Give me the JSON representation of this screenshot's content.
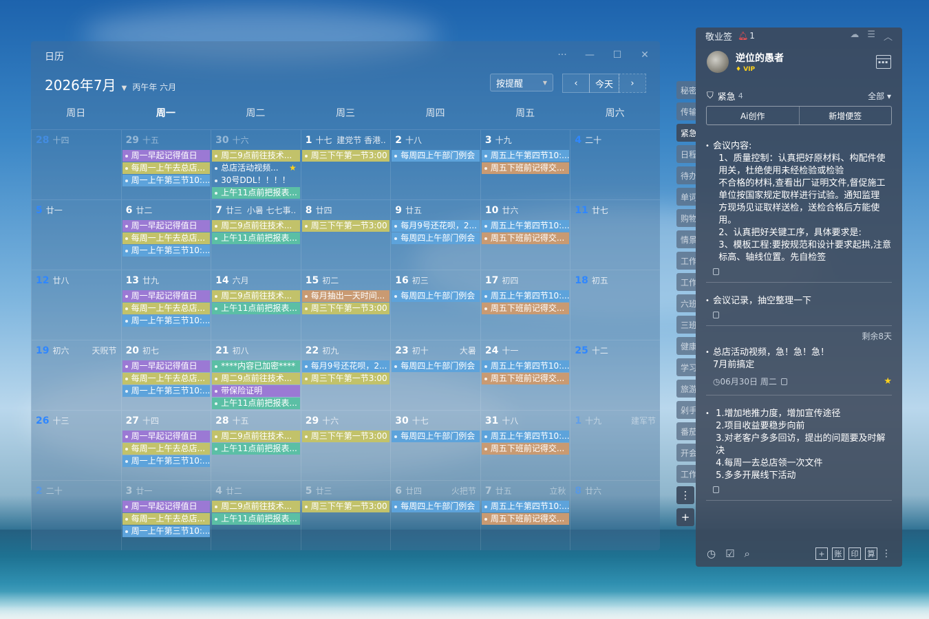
{
  "calendar": {
    "title": "日历",
    "month": "2026年7月",
    "lunar": "丙午年 六月",
    "remind_select": "按提醒",
    "today_label": "今天",
    "weekdays": [
      "周日",
      "周一",
      "周二",
      "周三",
      "周四",
      "周五",
      "周六"
    ],
    "active_weekday": 1,
    "weeks": [
      [
        {
          "num": "28",
          "lunar": "十四",
          "dim": true,
          "wknd": true,
          "events": []
        },
        {
          "num": "29",
          "lunar": "十五",
          "dim": true,
          "events": [
            {
              "t": "周一早起记得值日",
              "c": "purple"
            },
            {
              "t": "每周一上午去总店...",
              "c": "olive"
            },
            {
              "t": "周一上午第三节10:...",
              "c": "blue"
            }
          ]
        },
        {
          "num": "30",
          "lunar": "十六",
          "dim": true,
          "events": [
            {
              "t": "周二9点前往技术...",
              "c": "olive"
            },
            {
              "t": "总店活动视频...",
              "c": "plain",
              "star": true
            },
            {
              "t": "30号DDL！！！！",
              "c": "plain"
            },
            {
              "t": "上午11点前把报表...",
              "c": "teal"
            }
          ]
        },
        {
          "num": "1",
          "lunar": "十七",
          "fest": "建党节 香港...",
          "events": [
            {
              "t": "周三下午第一节3:00",
              "c": "olive"
            }
          ]
        },
        {
          "num": "2",
          "lunar": "十八",
          "events": [
            {
              "t": "每周四上午部门例会",
              "c": "blue"
            }
          ]
        },
        {
          "num": "3",
          "lunar": "十九",
          "events": [
            {
              "t": "周五上午第四节10:...",
              "c": "blue"
            },
            {
              "t": "周五下班前记得交...",
              "c": "orange"
            }
          ]
        },
        {
          "num": "4",
          "lunar": "二十",
          "wknd": true,
          "events": []
        }
      ],
      [
        {
          "num": "5",
          "lunar": "廿一",
          "wknd": true,
          "events": []
        },
        {
          "num": "6",
          "lunar": "廿二",
          "events": [
            {
              "t": "周一早起记得值日",
              "c": "purple"
            },
            {
              "t": "每周一上午去总店...",
              "c": "olive"
            },
            {
              "t": "周一上午第三节10:...",
              "c": "blue"
            }
          ]
        },
        {
          "num": "7",
          "lunar": "廿三",
          "fest": "小暑 七七事...",
          "events": [
            {
              "t": "周二9点前往技术...",
              "c": "olive"
            },
            {
              "t": "上午11点前把报表...",
              "c": "teal"
            }
          ]
        },
        {
          "num": "8",
          "lunar": "廿四",
          "events": [
            {
              "t": "周三下午第一节3:00",
              "c": "olive"
            }
          ]
        },
        {
          "num": "9",
          "lunar": "廿五",
          "events": [
            {
              "t": "每月9号还花呗，2...",
              "c": "blue"
            },
            {
              "t": "每周四上午部门例会",
              "c": "blue"
            }
          ]
        },
        {
          "num": "10",
          "lunar": "廿六",
          "events": [
            {
              "t": "周五上午第四节10:...",
              "c": "blue"
            },
            {
              "t": "周五下班前记得交...",
              "c": "orange"
            }
          ]
        },
        {
          "num": "11",
          "lunar": "廿七",
          "wknd": true,
          "events": []
        }
      ],
      [
        {
          "num": "12",
          "lunar": "廿八",
          "wknd": true,
          "events": []
        },
        {
          "num": "13",
          "lunar": "廿九",
          "events": [
            {
              "t": "周一早起记得值日",
              "c": "purple"
            },
            {
              "t": "每周一上午去总店...",
              "c": "olive"
            },
            {
              "t": "周一上午第三节10:...",
              "c": "blue"
            }
          ]
        },
        {
          "num": "14",
          "lunar": "六月",
          "events": [
            {
              "t": "周二9点前往技术...",
              "c": "olive"
            },
            {
              "t": "上午11点前把报表...",
              "c": "teal"
            }
          ]
        },
        {
          "num": "15",
          "lunar": "初二",
          "events": [
            {
              "t": "每月抽出一天时间...",
              "c": "orange"
            },
            {
              "t": "周三下午第一节3:00",
              "c": "olive"
            }
          ]
        },
        {
          "num": "16",
          "lunar": "初三",
          "events": [
            {
              "t": "每周四上午部门例会",
              "c": "blue"
            }
          ]
        },
        {
          "num": "17",
          "lunar": "初四",
          "events": [
            {
              "t": "周五上午第四节10:...",
              "c": "blue"
            },
            {
              "t": "周五下班前记得交...",
              "c": "orange"
            }
          ]
        },
        {
          "num": "18",
          "lunar": "初五",
          "wknd": true,
          "events": []
        }
      ],
      [
        {
          "num": "19",
          "lunar": "初六",
          "fest": "天贶节",
          "wknd": true,
          "events": []
        },
        {
          "num": "20",
          "lunar": "初七",
          "events": [
            {
              "t": "周一早起记得值日",
              "c": "purple"
            },
            {
              "t": "每周一上午去总店...",
              "c": "olive"
            },
            {
              "t": "周一上午第三节10:...",
              "c": "blue"
            }
          ]
        },
        {
          "num": "21",
          "lunar": "初八",
          "events": [
            {
              "t": "****内容已加密****",
              "c": "teal"
            },
            {
              "t": "周二9点前往技术...",
              "c": "olive"
            },
            {
              "t": "带保险证明",
              "c": "purple"
            },
            {
              "t": "上午11点前把报表...",
              "c": "teal"
            }
          ]
        },
        {
          "num": "22",
          "lunar": "初九",
          "events": [
            {
              "t": "每月9号还花呗，2...",
              "c": "blue"
            },
            {
              "t": "周三下午第一节3:00",
              "c": "olive"
            }
          ]
        },
        {
          "num": "23",
          "lunar": "初十",
          "fest": "大暑",
          "events": [
            {
              "t": "每周四上午部门例会",
              "c": "blue"
            }
          ]
        },
        {
          "num": "24",
          "lunar": "十一",
          "events": [
            {
              "t": "周五上午第四节10:...",
              "c": "blue"
            },
            {
              "t": "周五下班前记得交...",
              "c": "orange"
            }
          ]
        },
        {
          "num": "25",
          "lunar": "十二",
          "wknd": true,
          "events": []
        }
      ],
      [
        {
          "num": "26",
          "lunar": "十三",
          "wknd": true,
          "events": []
        },
        {
          "num": "27",
          "lunar": "十四",
          "events": [
            {
              "t": "周一早起记得值日",
              "c": "purple"
            },
            {
              "t": "每周一上午去总店...",
              "c": "olive"
            },
            {
              "t": "周一上午第三节10:...",
              "c": "blue"
            }
          ]
        },
        {
          "num": "28",
          "lunar": "十五",
          "events": [
            {
              "t": "周二9点前往技术...",
              "c": "olive"
            },
            {
              "t": "上午11点前把报表...",
              "c": "teal"
            }
          ]
        },
        {
          "num": "29",
          "lunar": "十六",
          "events": [
            {
              "t": "周三下午第一节3:00",
              "c": "olive"
            }
          ]
        },
        {
          "num": "30",
          "lunar": "十七",
          "events": [
            {
              "t": "每周四上午部门例会",
              "c": "blue"
            }
          ]
        },
        {
          "num": "31",
          "lunar": "十八",
          "events": [
            {
              "t": "周五上午第四节10:...",
              "c": "blue"
            },
            {
              "t": "周五下班前记得交...",
              "c": "orange"
            }
          ]
        },
        {
          "num": "1",
          "lunar": "十九",
          "fest": "建军节",
          "dim": true,
          "wknd": true,
          "events": []
        }
      ],
      [
        {
          "num": "2",
          "lunar": "二十",
          "dim": true,
          "wknd": true,
          "events": []
        },
        {
          "num": "3",
          "lunar": "廿一",
          "dim": true,
          "events": [
            {
              "t": "周一早起记得值日",
              "c": "purple"
            },
            {
              "t": "每周一上午去总店...",
              "c": "olive"
            },
            {
              "t": "周一上午第三节10:...",
              "c": "blue"
            }
          ]
        },
        {
          "num": "4",
          "lunar": "廿二",
          "dim": true,
          "events": [
            {
              "t": "周二9点前往技术...",
              "c": "olive"
            },
            {
              "t": "上午11点前把报表...",
              "c": "teal"
            }
          ]
        },
        {
          "num": "5",
          "lunar": "廿三",
          "dim": true,
          "events": [
            {
              "t": "周三下午第一节3:00",
              "c": "olive"
            }
          ]
        },
        {
          "num": "6",
          "lunar": "廿四",
          "fest": "火把节",
          "dim": true,
          "events": [
            {
              "t": "每周四上午部门例会",
              "c": "blue"
            }
          ]
        },
        {
          "num": "7",
          "lunar": "廿五",
          "fest": "立秋",
          "dim": true,
          "events": [
            {
              "t": "周五上午第四节10:...",
              "c": "blue"
            },
            {
              "t": "周五下班前记得交...",
              "c": "orange"
            }
          ]
        },
        {
          "num": "8",
          "lunar": "廿六",
          "dim": true,
          "wknd": true,
          "events": []
        }
      ]
    ]
  },
  "side_tabs": [
    "秘密",
    "传输",
    "紧急",
    "日程",
    "待办",
    "单词",
    "购物",
    "情景",
    "工作",
    "工作",
    "六班",
    "三班",
    "健康",
    "学习",
    "旅游",
    "剁手",
    "番茄",
    "开会",
    "工作"
  ],
  "side_tabs_active": 2,
  "side_more": "⋮",
  "side_add": "+",
  "note": {
    "app_title": "敬业签",
    "bell_count": "1",
    "username": "逆位的愚者",
    "vip_label": "VIP",
    "category": "紧急",
    "category_count": "4",
    "filter": "全部",
    "ai_button": "Ai创作",
    "new_button": "新增便签",
    "items": [
      {
        "text": "会议内容:\n  1、质量控制：认真把好原材料、构配件使\n  用关，杜绝使用未经检验或检验\n  不合格的材料,查看出厂证明文件,督促施工\n  单位按国家规定取样进行试验。通知监理\n  方现场见证取样送检，送检合格后方能使\n  用。\n  2、认真把好关键工序，具体要求是:\n  3、模板工程:要按规范和设计要求起拱,注意\n  标高、轴线位置。先自检签"
      },
      {
        "text": "会议记录，抽空整理一下"
      },
      {
        "text": "总店活动视频，急！急！急！\n7月前搞定",
        "remain": "剩余8天",
        "date": "06月30日 周二",
        "star": true
      },
      {
        "text": " 1.增加地推力度，增加宣传途径\n 2.项目收益要稳步向前\n 3.对老客户多多回访，提出的问题要及时解\n 决\n 4.每周一去总店领一次文件\n 5.多多开展线下活动"
      }
    ],
    "bottom_buttons": [
      "+",
      "账",
      "印",
      "算"
    ]
  }
}
